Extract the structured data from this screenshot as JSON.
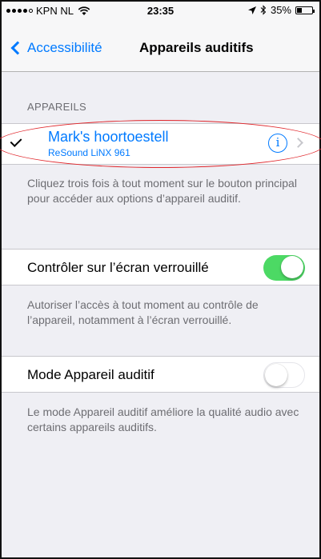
{
  "status_bar": {
    "carrier": "KPN NL",
    "time": "23:35",
    "battery_text": "35%",
    "battery_level": 0.35,
    "signal_bars": 4,
    "icons": [
      "wifi-icon",
      "location-icon",
      "bluetooth-icon",
      "battery-icon"
    ]
  },
  "nav": {
    "back_label": "Accessibilité",
    "title": "Appareils auditifs"
  },
  "devices_section": {
    "header": "APPAREILS",
    "device_name": "Mark's hoortoestell",
    "device_model": "ReSound LiNX 961",
    "info_glyph": "i",
    "footer": "Cliquez trois fois à tout moment sur le bouton principal pour accéder aux options d’appareil auditif."
  },
  "lock_screen": {
    "label": "Contrôler sur l’écran verrouillé",
    "enabled": true,
    "footer": "Autoriser l’accès à tout moment au contrôle de l’appareil, notamment à l’écran verrouillé."
  },
  "hearing_mode": {
    "label": "Mode Appareil auditif",
    "enabled": false,
    "footer": "Le mode Appareil auditif améliore la qualité audio avec certains appareils auditifs."
  },
  "colors": {
    "accent": "#007aff",
    "switch_on": "#4cd964",
    "annotation": "#e0262b"
  }
}
